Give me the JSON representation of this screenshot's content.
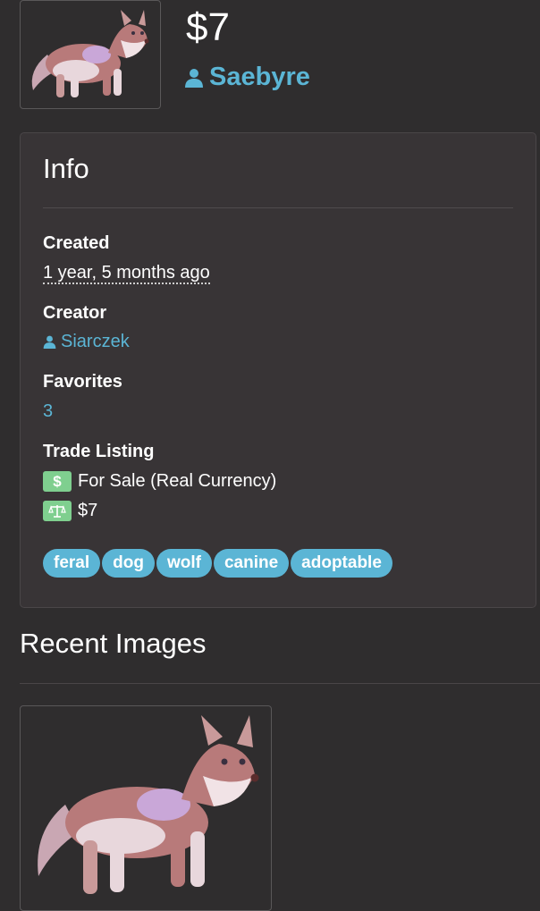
{
  "header": {
    "price": "$7",
    "owner": "Saebyre"
  },
  "info": {
    "title": "Info",
    "created_label": "Created",
    "created_value": "1 year, 5 months ago",
    "creator_label": "Creator",
    "creator_value": "Siarczek",
    "favorites_label": "Favorites",
    "favorites_value": "3",
    "trade_label": "Trade Listing",
    "trade_type": "For Sale (Real Currency)",
    "trade_price": "$7",
    "tags": [
      "feral",
      "dog",
      "wolf",
      "canine",
      "adoptable"
    ]
  },
  "recent": {
    "title": "Recent Images"
  },
  "colors": {
    "background": "#2f2d2e",
    "card": "#383436",
    "link": "#5bb5d5",
    "badge_green": "#7fcf8f"
  }
}
